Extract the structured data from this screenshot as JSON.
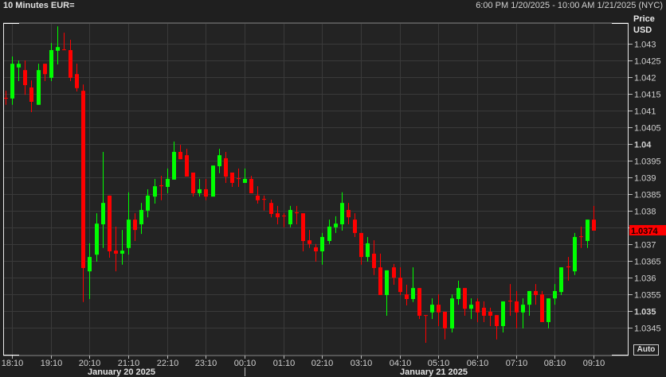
{
  "header": {
    "title": "10 Minutes EUR=",
    "range": "6:00 PM 1/20/2025 - 10:00 AM 1/21/2025 (NYC)"
  },
  "axis": {
    "price_label": "Price",
    "currency_label": "USD",
    "auto_label": "Auto"
  },
  "dates": [
    "January 20 2025",
    "January 21 2025"
  ],
  "chart_data": {
    "type": "candlestick",
    "title": "10 Minutes EUR=",
    "interval_minutes": 10,
    "start_time": "18:00",
    "ylabel": "Price USD",
    "ylim": [
      1.0339,
      1.0436
    ],
    "last_price": "1.0374",
    "colors": {
      "up": "#00ff00",
      "down": "#ff0000",
      "grid": "#3a3a3a",
      "tag": "#ff0000"
    },
    "yticks": [
      {
        "v": 1.043,
        "label": "1.043"
      },
      {
        "v": 1.0425,
        "label": "1.0425"
      },
      {
        "v": 1.042,
        "label": "1.042"
      },
      {
        "v": 1.0415,
        "label": "1.0415"
      },
      {
        "v": 1.041,
        "label": "1.041"
      },
      {
        "v": 1.0405,
        "label": "1.0405"
      },
      {
        "v": 1.04,
        "label": "1.04",
        "bold": true
      },
      {
        "v": 1.0395,
        "label": "1.0395"
      },
      {
        "v": 1.039,
        "label": "1.039"
      },
      {
        "v": 1.0385,
        "label": "1.0385"
      },
      {
        "v": 1.038,
        "label": "1.038"
      },
      {
        "v": 1.0375,
        "label": "1.0375"
      },
      {
        "v": 1.037,
        "label": "1.037"
      },
      {
        "v": 1.0365,
        "label": "1.0365"
      },
      {
        "v": 1.036,
        "label": "1.036"
      },
      {
        "v": 1.0355,
        "label": "1.0355"
      },
      {
        "v": 1.035,
        "label": "1.035",
        "bold": true
      },
      {
        "v": 1.0345,
        "label": "1.0345"
      }
    ],
    "xticks": [
      "18:10",
      "19:10",
      "20:10",
      "21:10",
      "22:10",
      "23:10",
      "00:10",
      "01:10",
      "02:10",
      "03:10",
      "04:10",
      "05:10",
      "06:10",
      "07:10",
      "08:10",
      "09:10"
    ],
    "ohlc": [
      [
        1.04138,
        1.04159,
        1.04117,
        1.04136
      ],
      [
        1.04136,
        1.04262,
        1.04117,
        1.0424
      ],
      [
        1.04229,
        1.0425,
        1.04188,
        1.0424
      ],
      [
        1.04221,
        1.0425,
        1.04147,
        1.04176
      ],
      [
        1.04169,
        1.0419,
        1.04095,
        1.04126
      ],
      [
        1.04117,
        1.0424,
        1.04117,
        1.04221
      ],
      [
        1.0424,
        1.0424,
        1.04188,
        1.04209
      ],
      [
        1.04198,
        1.04302,
        1.04188,
        1.04281
      ],
      [
        1.04279,
        1.04352,
        1.04238,
        1.0429
      ],
      [
        1.04283,
        1.04333,
        1.04281,
        1.04281
      ],
      [
        1.04281,
        1.04312,
        1.04188,
        1.04198
      ],
      [
        1.04209,
        1.0424,
        1.04157,
        1.04167
      ],
      [
        1.04159,
        1.04178,
        1.03526,
        1.03628
      ],
      [
        1.03618,
        1.03702,
        1.03535,
        1.03661
      ],
      [
        1.03668,
        1.03792,
        1.03647,
        1.03761
      ],
      [
        1.03759,
        1.03976,
        1.03688,
        1.03823
      ],
      [
        1.03845,
        1.03845,
        1.03659,
        1.03678
      ],
      [
        1.0368,
        1.03752,
        1.03618,
        1.03671
      ],
      [
        1.03671,
        1.03742,
        1.03638,
        1.0368
      ],
      [
        1.03688,
        1.03855,
        1.03668,
        1.03773
      ],
      [
        1.03773,
        1.03792,
        1.03709,
        1.03742
      ],
      [
        1.03759,
        1.03823,
        1.0373,
        1.03802
      ],
      [
        1.038,
        1.03864,
        1.0378,
        1.03845
      ],
      [
        1.03842,
        1.03895,
        1.03821,
        1.03873
      ],
      [
        1.03876,
        1.03904,
        1.03831,
        1.03873
      ],
      [
        1.03871,
        1.03926,
        1.03852,
        1.03895
      ],
      [
        1.03893,
        1.04007,
        1.03893,
        1.03976
      ],
      [
        1.03976,
        1.03997,
        1.03954,
        1.03954
      ],
      [
        1.03966,
        1.03985,
        1.03902,
        1.03902
      ],
      [
        1.03914,
        1.03914,
        1.03842,
        1.03852
      ],
      [
        1.03852,
        1.03895,
        1.03842,
        1.03864
      ],
      [
        1.03864,
        1.03895,
        1.03831,
        1.03842
      ],
      [
        1.03842,
        1.03935,
        1.03842,
        1.03935
      ],
      [
        1.03933,
        1.03985,
        1.03912,
        1.03966
      ],
      [
        1.03957,
        1.03976,
        1.03883,
        1.03902
      ],
      [
        1.03914,
        1.03914,
        1.03871,
        1.03883
      ],
      [
        1.03897,
        1.03926,
        1.03871,
        1.03895
      ],
      [
        1.03883,
        1.03926,
        1.03883,
        1.03895
      ],
      [
        1.03895,
        1.03904,
        1.03852,
        1.03852
      ],
      [
        1.03845,
        1.03873,
        1.03821,
        1.03831
      ],
      [
        1.03835,
        1.03845,
        1.038,
        1.03833
      ],
      [
        1.03823,
        1.03833,
        1.0378,
        1.0379
      ],
      [
        1.03792,
        1.03814,
        1.03759,
        1.0378
      ],
      [
        1.03785,
        1.03792,
        1.0375,
        1.03783
      ],
      [
        1.03759,
        1.03814,
        1.0375,
        1.03802
      ],
      [
        1.03795,
        1.03814,
        1.03759,
        1.03792
      ],
      [
        1.03792,
        1.03792,
        1.03678,
        1.03709
      ],
      [
        1.03711,
        1.03742,
        1.03688,
        1.037
      ],
      [
        1.0369,
        1.037,
        1.03647,
        1.03678
      ],
      [
        1.03678,
        1.03733,
        1.03638,
        1.03721
      ],
      [
        1.03709,
        1.03773,
        1.037,
        1.03752
      ],
      [
        1.0375,
        1.03783,
        1.03733,
        1.03761
      ],
      [
        1.03759,
        1.03855,
        1.0374,
        1.03823
      ],
      [
        1.03802,
        1.03823,
        1.03759,
        1.0378
      ],
      [
        1.03773,
        1.03792,
        1.03721,
        1.03733
      ],
      [
        1.03733,
        1.03733,
        1.03638,
        1.03661
      ],
      [
        1.03661,
        1.03721,
        1.03647,
        1.03702
      ],
      [
        1.03671,
        1.03711,
        1.03607,
        1.03628
      ],
      [
        1.0363,
        1.03671,
        1.03547,
        1.03547
      ],
      [
        1.03547,
        1.03621,
        1.03485,
        1.03621
      ],
      [
        1.0363,
        1.0364,
        1.03578,
        1.03599
      ],
      [
        1.03599,
        1.0363,
        1.03547,
        1.03556
      ],
      [
        1.03549,
        1.03578,
        1.03516,
        1.03535
      ],
      [
        1.03535,
        1.0363,
        1.03526,
        1.03568
      ],
      [
        1.03568,
        1.03568,
        1.03475,
        1.03485
      ],
      [
        1.03487,
        1.03487,
        1.03404,
        1.03485
      ],
      [
        1.03495,
        1.03537,
        1.03475,
        1.03518
      ],
      [
        1.03518,
        1.03549,
        1.03454,
        1.03495
      ],
      [
        1.03497,
        1.03497,
        1.03414,
        1.03447
      ],
      [
        1.03447,
        1.03549,
        1.03435,
        1.03537
      ],
      [
        1.03535,
        1.0359,
        1.03518,
        1.03568
      ],
      [
        1.03568,
        1.03568,
        1.03485,
        1.03506
      ],
      [
        1.03506,
        1.03537,
        1.03475,
        1.03518
      ],
      [
        1.03528,
        1.03537,
        1.03466,
        1.03495
      ],
      [
        1.03509,
        1.03528,
        1.03466,
        1.03485
      ],
      [
        1.03497,
        1.03509,
        1.03454,
        1.03485
      ],
      [
        1.03487,
        1.03487,
        1.03414,
        1.03454
      ],
      [
        1.03454,
        1.03528,
        1.03435,
        1.03528
      ],
      [
        1.0353,
        1.0358,
        1.03485,
        1.03528
      ],
      [
        1.03528,
        1.03559,
        1.03447,
        1.03495
      ],
      [
        1.03495,
        1.03537,
        1.03447,
        1.03518
      ],
      [
        1.03518,
        1.03559,
        1.03485,
        1.03559
      ],
      [
        1.03559,
        1.0358,
        1.03518,
        1.03547
      ],
      [
        1.03549,
        1.03559,
        1.03466,
        1.03466
      ],
      [
        1.03466,
        1.03537,
        1.03447,
        1.03537
      ],
      [
        1.03537,
        1.0358,
        1.03518,
        1.03559
      ],
      [
        1.03556,
        1.0363,
        1.03547,
        1.0363
      ],
      [
        1.03633,
        1.03661,
        1.0359,
        1.0363
      ],
      [
        1.03618,
        1.03733,
        1.03607,
        1.03721
      ],
      [
        1.03723,
        1.03752,
        1.03688,
        1.03721
      ],
      [
        1.03709,
        1.03773,
        1.03688,
        1.03773
      ],
      [
        1.03773,
        1.03814,
        1.0374,
        1.0374
      ]
    ]
  }
}
